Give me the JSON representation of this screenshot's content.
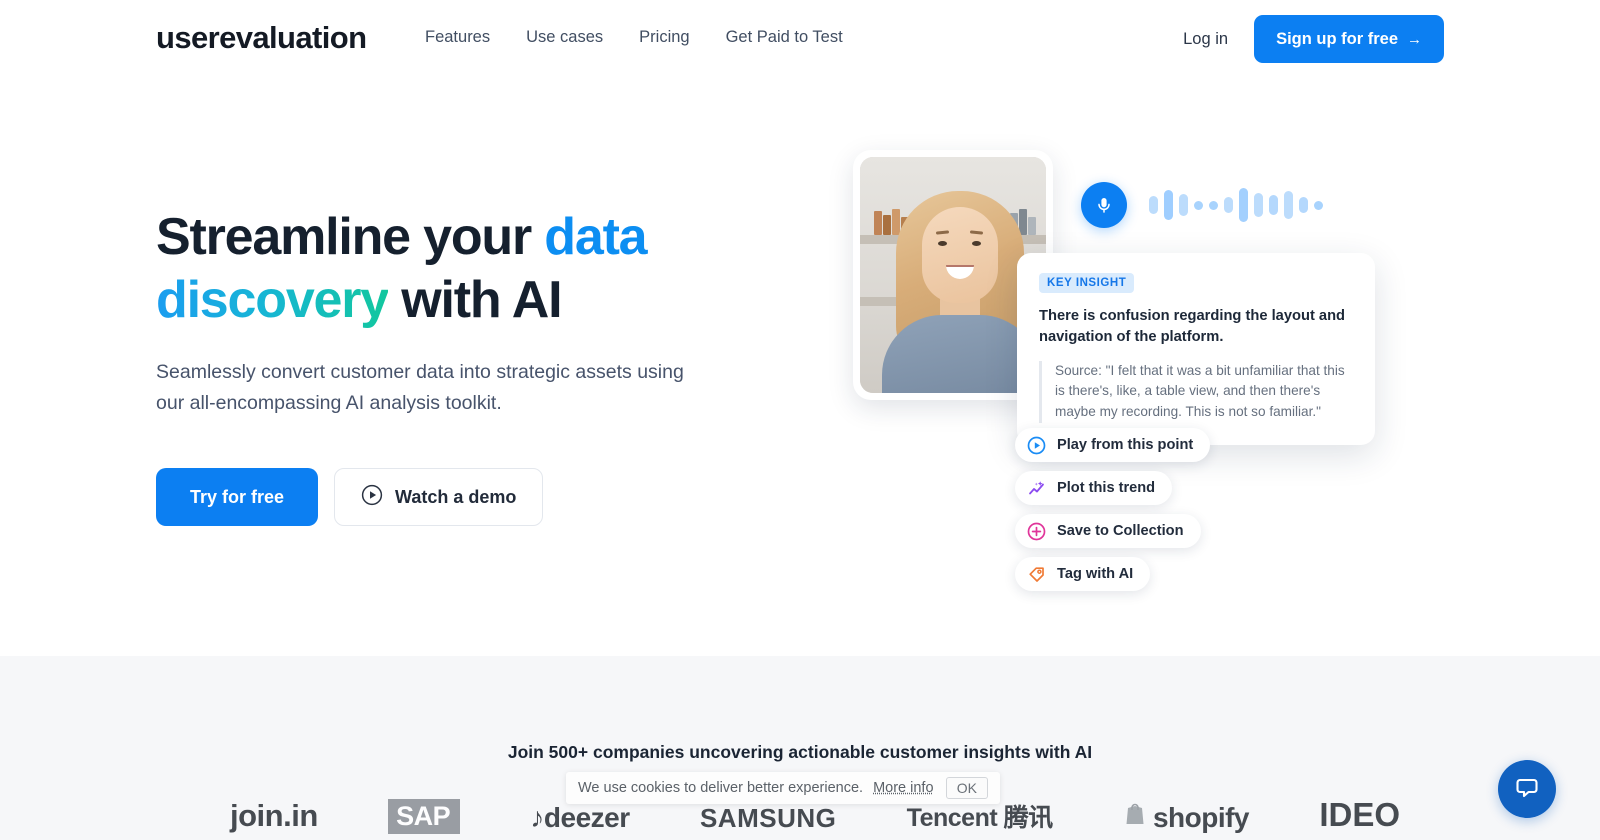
{
  "header": {
    "logo": "userevaluation",
    "nav": [
      {
        "label": "Features"
      },
      {
        "label": "Use cases"
      },
      {
        "label": "Pricing"
      },
      {
        "label": "Get Paid to Test"
      }
    ],
    "login_label": "Log in",
    "signup_label": "Sign up for free",
    "signup_arrow": "→"
  },
  "hero": {
    "headline_part1": "Streamline your ",
    "headline_data": "data",
    "headline_discovery": "discovery",
    "headline_part2": " with AI",
    "subhead": "Seamlessly convert customer data into strategic assets using our all-encompassing AI analysis toolkit.",
    "cta_primary": "Try for free",
    "cta_secondary": "Watch a demo"
  },
  "visual": {
    "waveform": [
      18,
      30,
      22,
      8,
      8,
      16,
      34,
      24,
      20,
      28,
      16,
      8
    ],
    "insight": {
      "badge": "KEY INSIGHT",
      "title": "There is confusion regarding the layout and navigation of the platform.",
      "quote": "Source: \"I felt that it was a bit unfamiliar that this is there's, like, a table view, and then there's maybe my recording. This is not so familiar.\""
    },
    "pills": [
      {
        "label": "Play from this point",
        "icon": "play-circle-icon",
        "color": "#1a8cf5"
      },
      {
        "label": "Plot this trend",
        "icon": "sparkle-trend-icon",
        "color": "#8b4bf0"
      },
      {
        "label": "Save to Collection",
        "icon": "plus-circle-icon",
        "color": "#e0359a"
      },
      {
        "label": "Tag with AI",
        "icon": "tag-icon",
        "color": "#f07a35"
      }
    ]
  },
  "proof": {
    "title": "Join 500+ companies uncovering actionable customer insights with AI",
    "logos": [
      {
        "name": "join.in"
      },
      {
        "name": "SAP"
      },
      {
        "name": "♪deezer"
      },
      {
        "name": "SAMSUNG"
      },
      {
        "name": "Tencent 腾讯"
      },
      {
        "name": "shopify"
      },
      {
        "name": "IDEO"
      }
    ]
  },
  "cookie": {
    "text": "We use cookies to deliver better experience.",
    "link": "More info",
    "ok": "OK"
  },
  "chat": {
    "icon": "chat-bubble-icon"
  },
  "colors": {
    "brand_blue": "#0c7ff2",
    "headline_dark": "#15202e",
    "teal": "#12c79e",
    "section_bg": "#f6f7f9"
  }
}
